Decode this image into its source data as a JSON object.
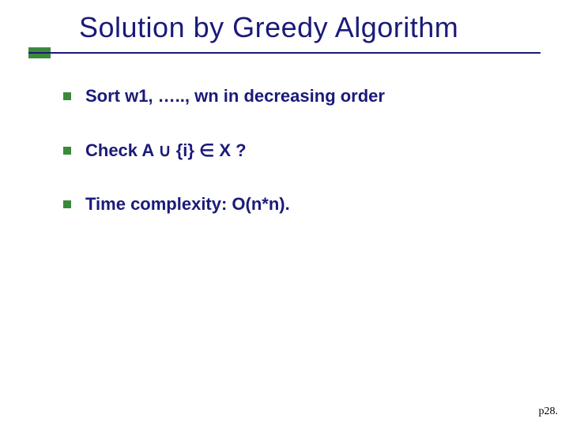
{
  "title": "Solution by Greedy Algorithm",
  "bullets": [
    {
      "text": "Sort  w1, ….., wn in decreasing order"
    },
    {
      "text": "Check  A ∪ {i} ∈ X ?"
    },
    {
      "text": "Time complexity:  O(n*n)."
    }
  ],
  "page_label": "p28."
}
